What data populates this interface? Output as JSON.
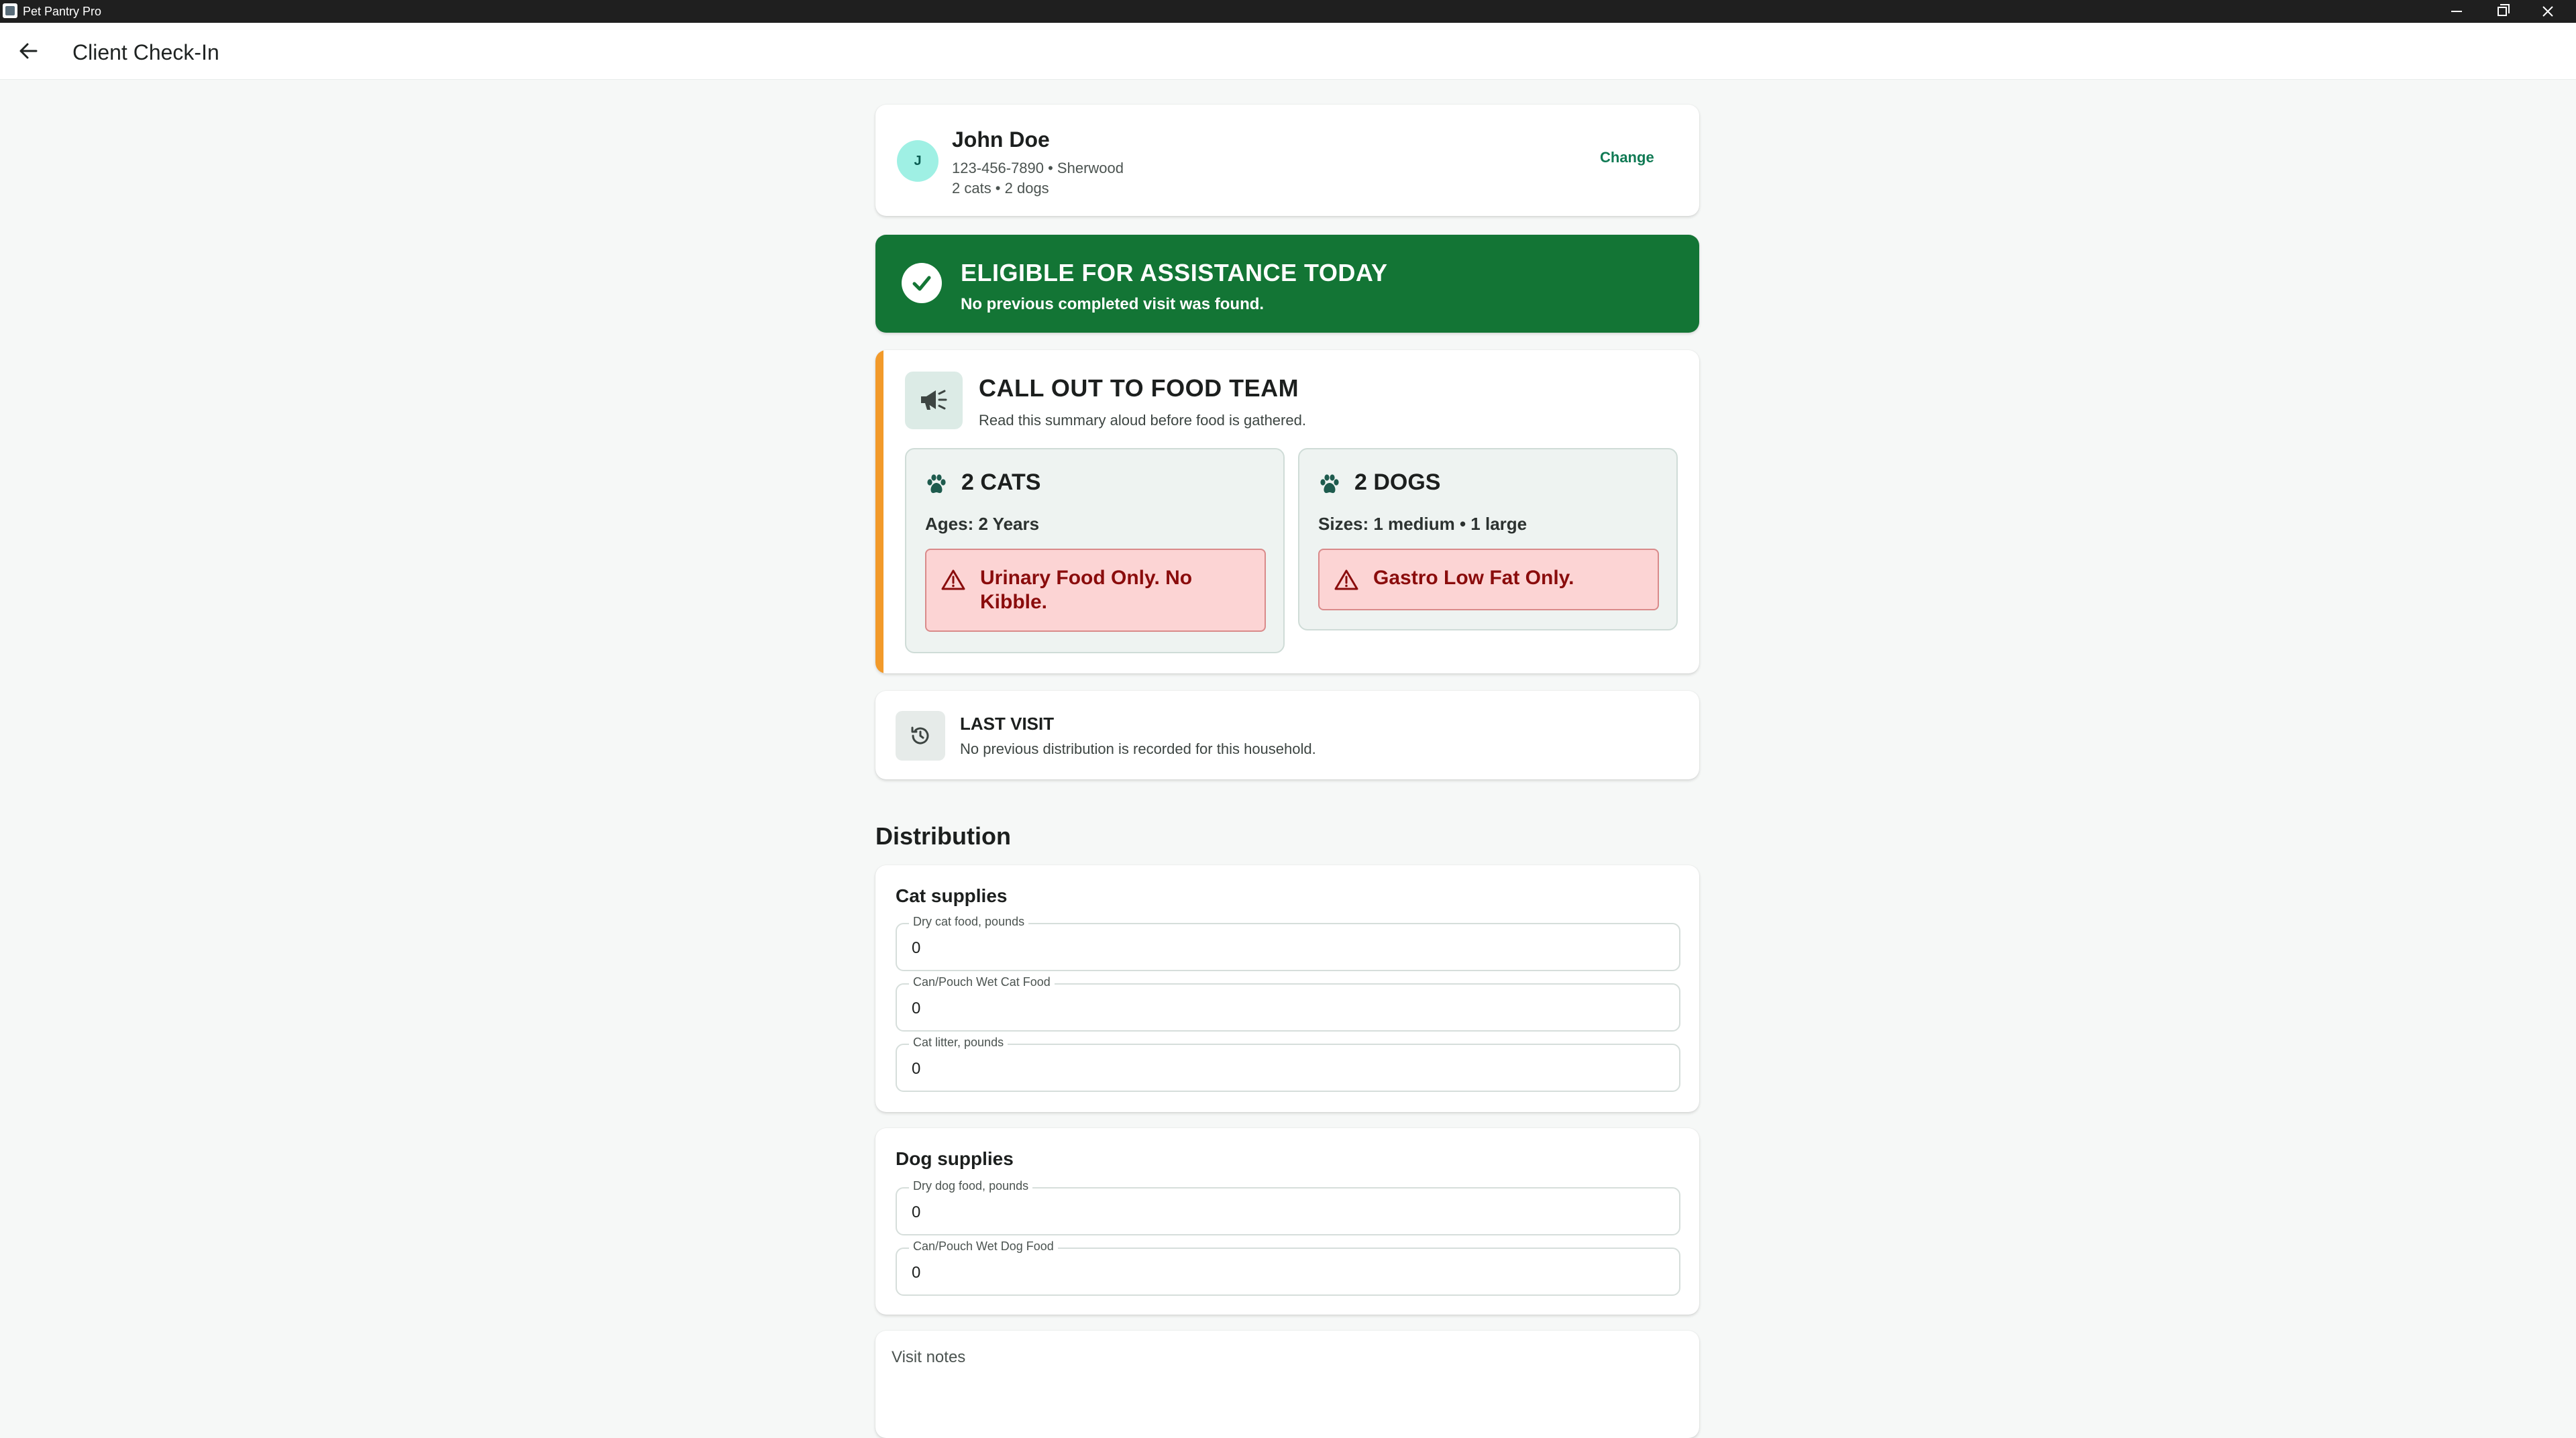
{
  "window": {
    "app_title": "Pet Pantry Pro"
  },
  "header": {
    "title": "Client Check-In"
  },
  "client": {
    "initial": "J",
    "name": "John Doe",
    "contact": "123-456-7890 • Sherwood",
    "pets_summary": "2 cats • 2 dogs",
    "change_label": "Change"
  },
  "eligibility": {
    "title": "ELIGIBLE FOR ASSISTANCE TODAY",
    "subtitle": "No previous completed visit was found.",
    "color": "#137535"
  },
  "callout": {
    "title": "CALL OUT TO FOOD TEAM",
    "subtitle": "Read this summary aloud before food is gathered.",
    "accent_color": "#f29a2a",
    "cats": {
      "title": "2 CATS",
      "detail": "Ages: 2 Years",
      "alert": "Urinary Food Only. No Kibble."
    },
    "dogs": {
      "title": "2 DOGS",
      "detail": "Sizes: 1 medium • 1 large",
      "alert": "Gastro Low Fat Only."
    }
  },
  "last_visit": {
    "title": "LAST VISIT",
    "subtitle": "No previous distribution is recorded for this household."
  },
  "distribution": {
    "title": "Distribution",
    "cat_supplies": {
      "title": "Cat supplies",
      "fields": [
        {
          "label": "Dry cat food, pounds",
          "value": "0"
        },
        {
          "label": "Can/Pouch Wet Cat Food",
          "value": "0"
        },
        {
          "label": "Cat litter, pounds",
          "value": "0"
        }
      ]
    },
    "dog_supplies": {
      "title": "Dog supplies",
      "fields": [
        {
          "label": "Dry dog food, pounds",
          "value": "0"
        },
        {
          "label": "Can/Pouch Wet Dog Food",
          "value": "0"
        }
      ]
    },
    "visit_notes_label": "Visit notes"
  },
  "icons": {
    "back": "arrow-left-icon",
    "check": "check-icon",
    "megaphone": "megaphone-icon",
    "paw": "paw-icon",
    "warning": "warning-triangle-icon",
    "history": "history-icon"
  }
}
